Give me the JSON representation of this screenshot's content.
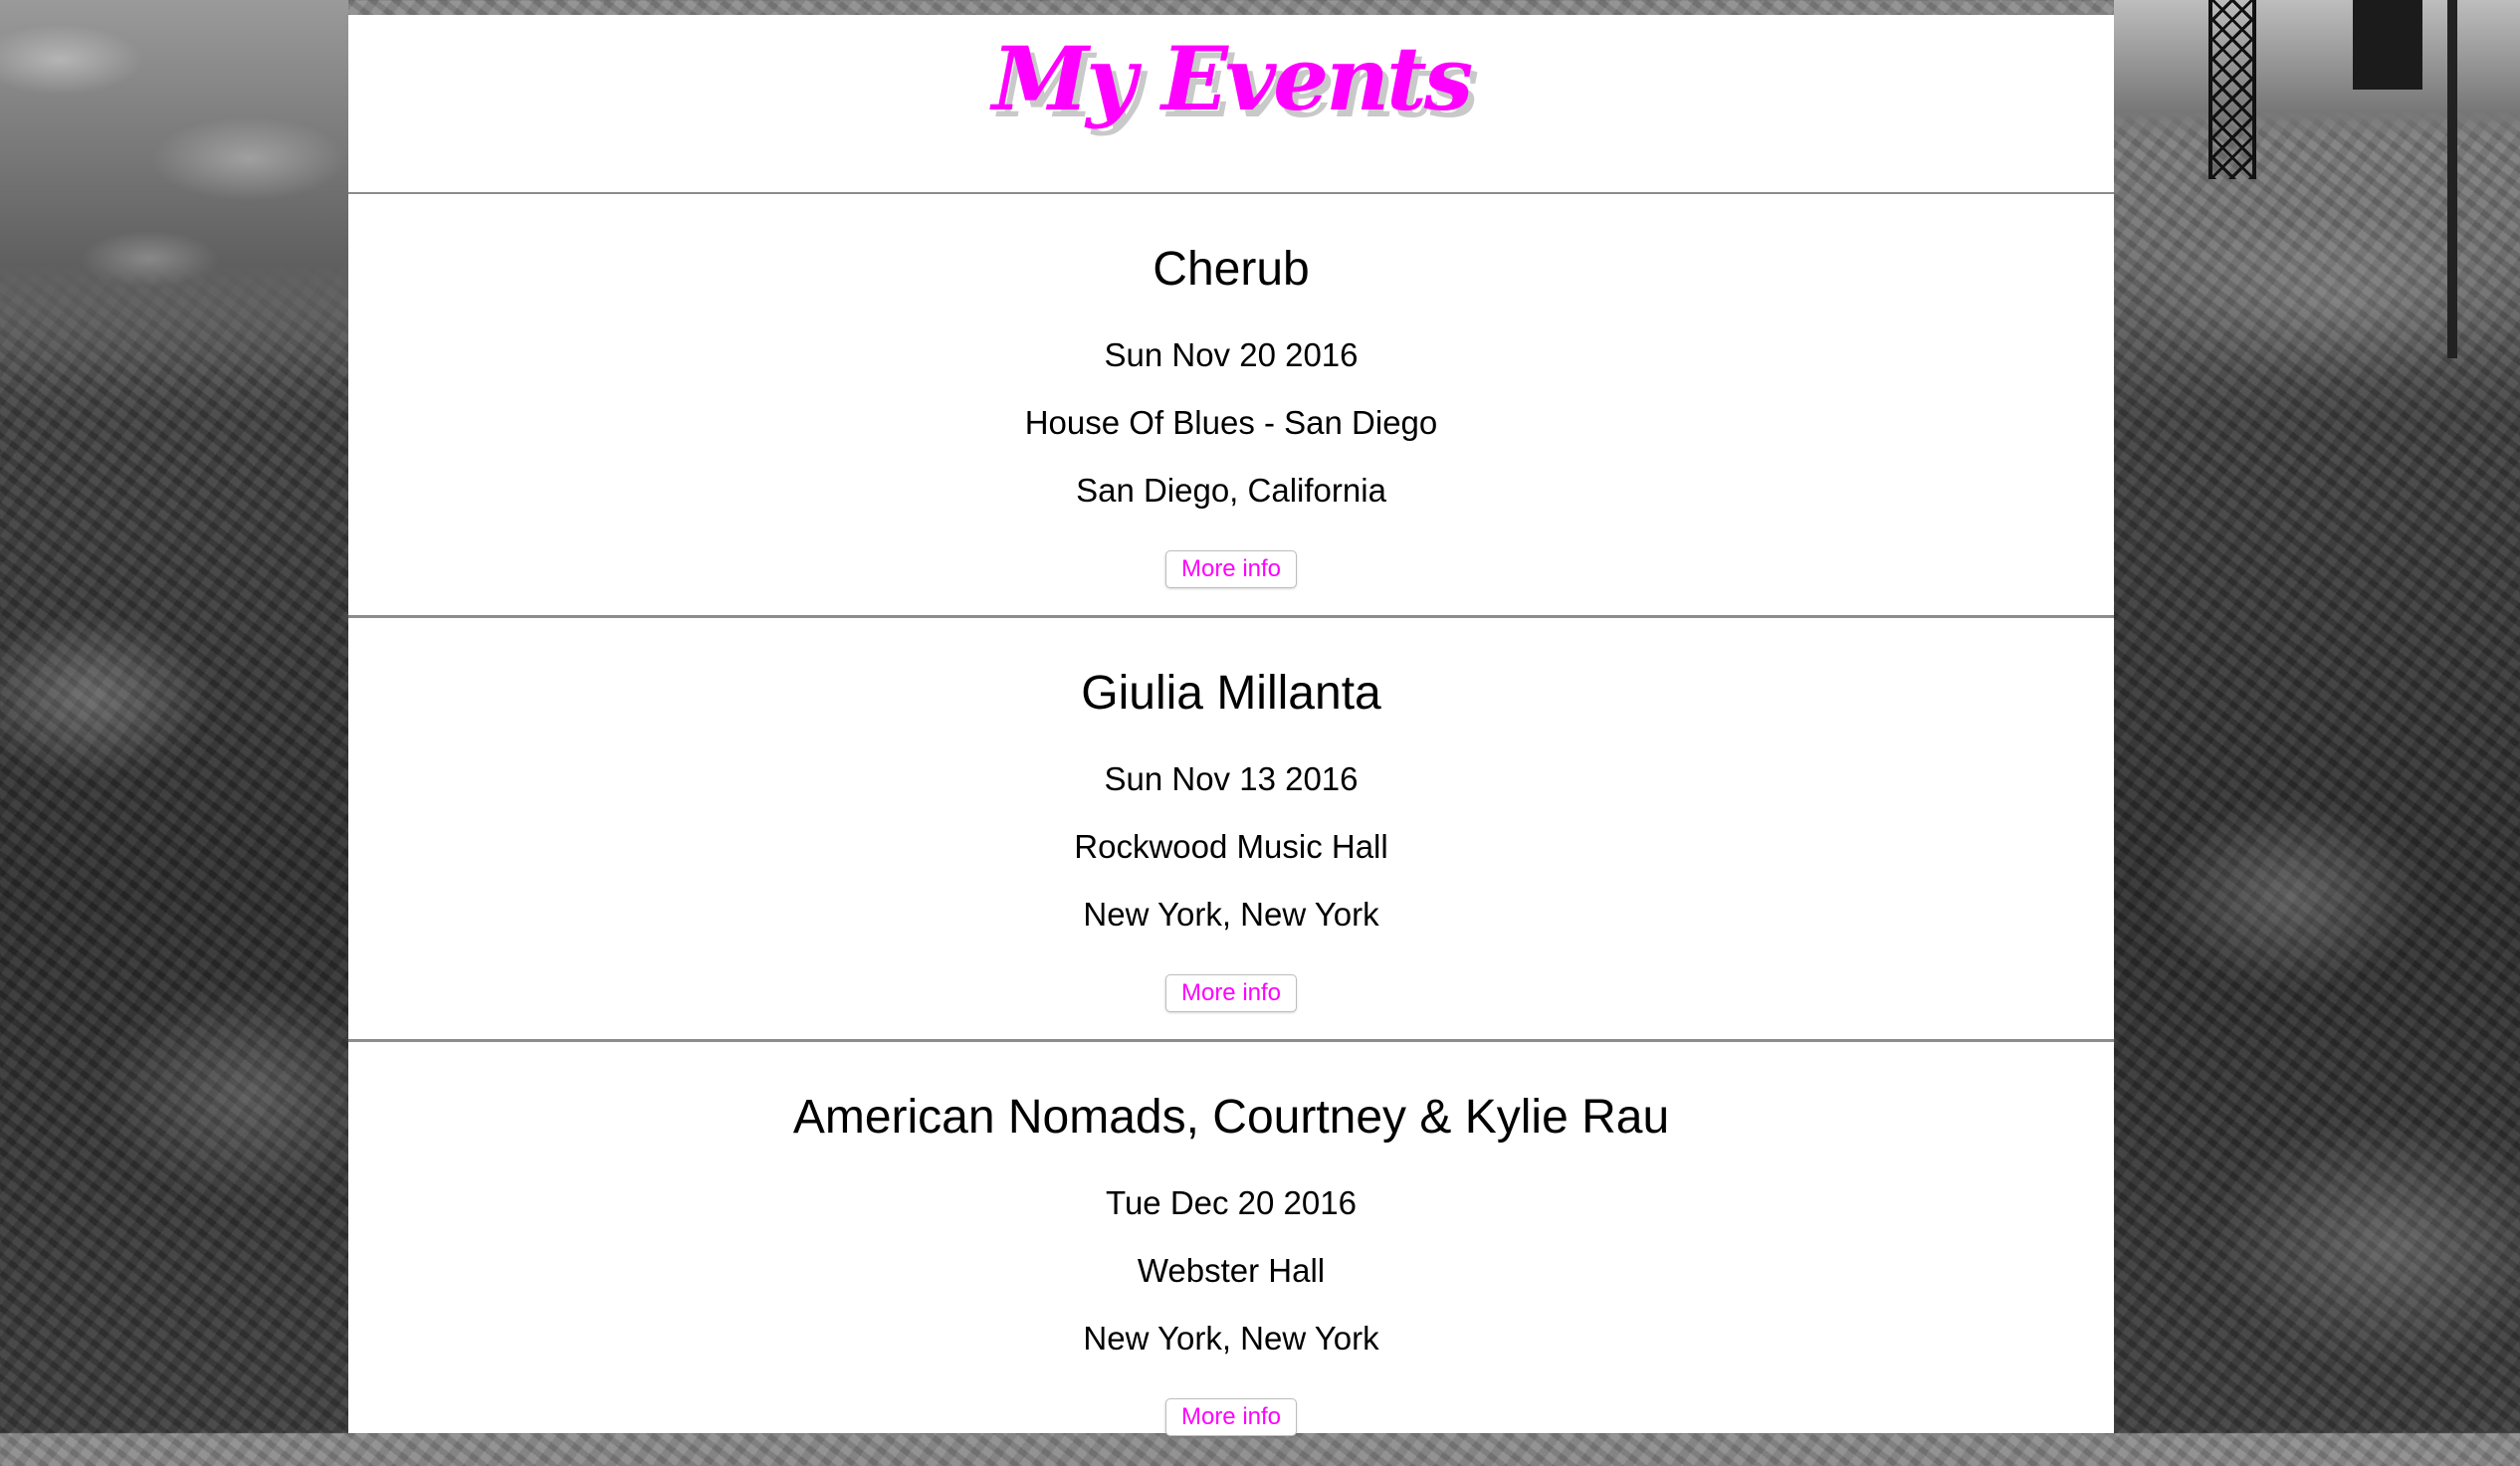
{
  "header": {
    "title": "My Events"
  },
  "events": [
    {
      "name": "Cherub",
      "date": "Sun Nov 20 2016",
      "venue": "House Of Blues - San Diego",
      "location": "San Diego, California",
      "button_label": "More info"
    },
    {
      "name": "Giulia Millanta",
      "date": "Sun Nov 13 2016",
      "venue": "Rockwood Music Hall",
      "location": "New York, New York",
      "button_label": "More info"
    },
    {
      "name": "American Nomads, Courtney & Kylie Rau",
      "date": "Tue Dec 20 2016",
      "venue": "Webster Hall",
      "location": "New York, New York",
      "button_label": "More info"
    }
  ],
  "colors": {
    "accent": "#ff00ff",
    "title_shadow": "#c9c9c9",
    "divider": "#8c8c8c",
    "panel": "#ffffff"
  }
}
